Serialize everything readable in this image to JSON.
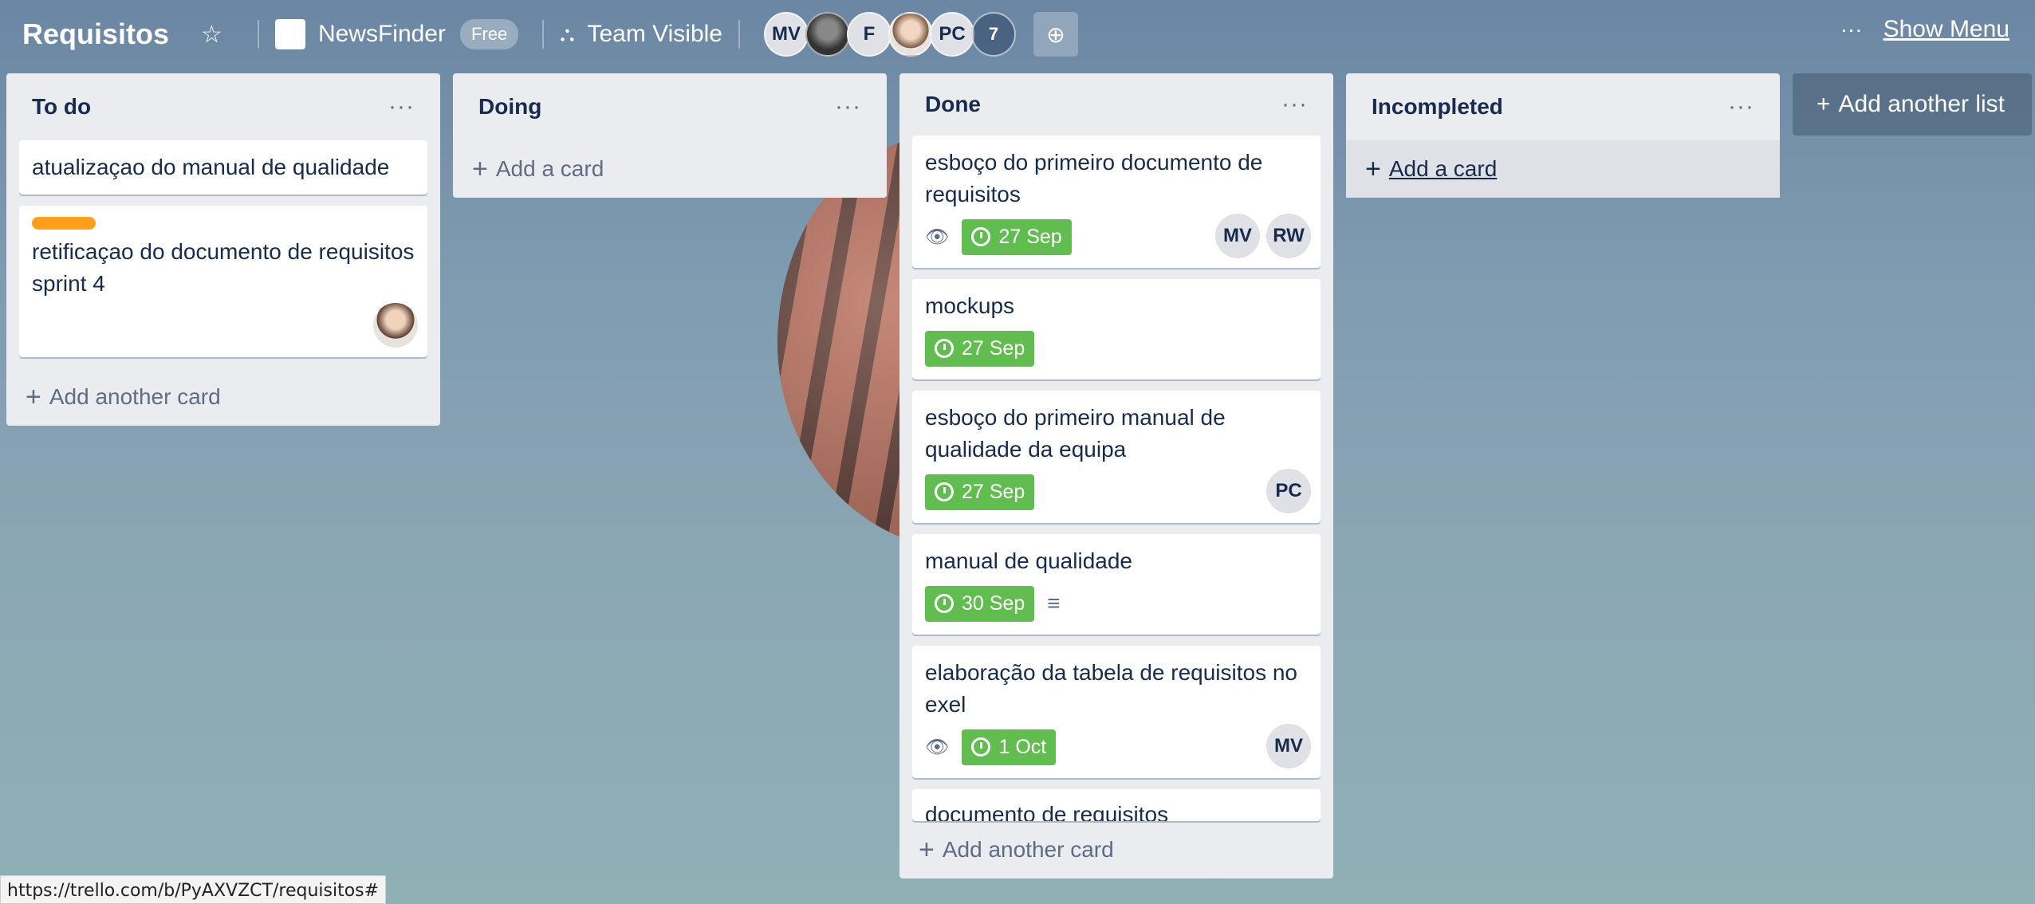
{
  "header": {
    "title": "Requisitos",
    "workspace": "NewsFinder",
    "plan_badge": "Free",
    "visibility": "Team Visible",
    "members": [
      "MV",
      "",
      "F",
      "",
      "PC"
    ],
    "members_more": "7",
    "show_menu": "Show Menu",
    "menu_dots": "···"
  },
  "lists": {
    "todo": {
      "title": "To do",
      "cards": [
        {
          "title": "atualizaçao do manual de qualidade"
        },
        {
          "title": "retificaçao do documento de requisitos sprint 4",
          "label_color": "#ff9f1a"
        }
      ],
      "add": "Add another card"
    },
    "doing": {
      "title": "Doing",
      "add": "Add a card"
    },
    "done": {
      "title": "Done",
      "cards": [
        {
          "title": "esboço do primeiro documento de requisitos",
          "due": "27 Sep",
          "members": [
            "MV",
            "RW"
          ]
        },
        {
          "title": "mockups",
          "due": "27 Sep"
        },
        {
          "title": "esboço do primeiro manual de qualidade da equipa",
          "due": "27 Sep",
          "members": [
            "PC"
          ]
        },
        {
          "title": "manual de qualidade",
          "due": "30 Sep"
        },
        {
          "title": "elaboração da tabela de requisitos no exel",
          "due": "1 Oct",
          "members": [
            "MV"
          ]
        },
        {
          "title": "documento de requisitos"
        }
      ],
      "add": "Add another card"
    },
    "incompleted": {
      "title": "Incompleted",
      "add": "Add a card"
    }
  },
  "add_list": "Add another list",
  "status_url": "https://trello.com/b/PyAXVZCT/requisitos#",
  "colors": {
    "due_complete": "#61bd4f",
    "label_orange": "#ff9f1a",
    "list_bg": "#ebecf0"
  }
}
